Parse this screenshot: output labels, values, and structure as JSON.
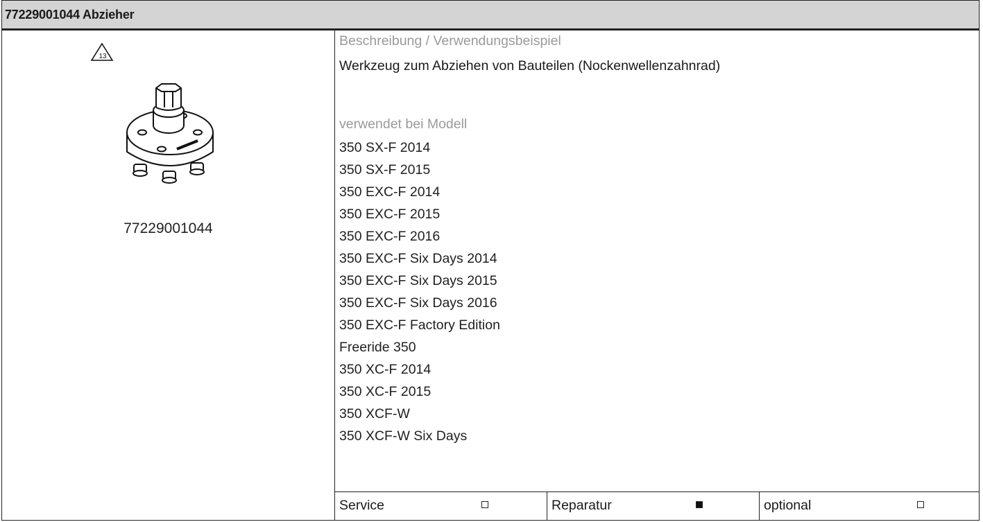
{
  "header": {
    "title": "77229001044 Abzieher"
  },
  "tool": {
    "part_number": "77229001044",
    "warning_icon_text": "13"
  },
  "description": {
    "label": "Beschreibung / Verwendungsbeispiel",
    "text": "Werkzeug zum Abziehen von Bauteilen (Nockenwellenzahnrad)"
  },
  "models": {
    "label": "verwendet bei Modell",
    "items": [
      "350 SX-F 2014",
      "350 SX-F 2015",
      "350 EXC-F 2014",
      "350 EXC-F 2015",
      "350 EXC-F 2016",
      "350 EXC-F Six Days 2014",
      "350 EXC-F Six Days 2015",
      "350 EXC-F Six Days 2016",
      "350 EXC-F Factory Edition",
      "Freeride 350",
      "350 XC-F 2014",
      "350 XC-F 2015",
      "350 XCF-W",
      "350 XCF-W Six Days"
    ]
  },
  "usage": [
    {
      "label": "Service",
      "checked": false
    },
    {
      "label": "Reparatur",
      "checked": true
    },
    {
      "label": "optional",
      "checked": false
    }
  ]
}
